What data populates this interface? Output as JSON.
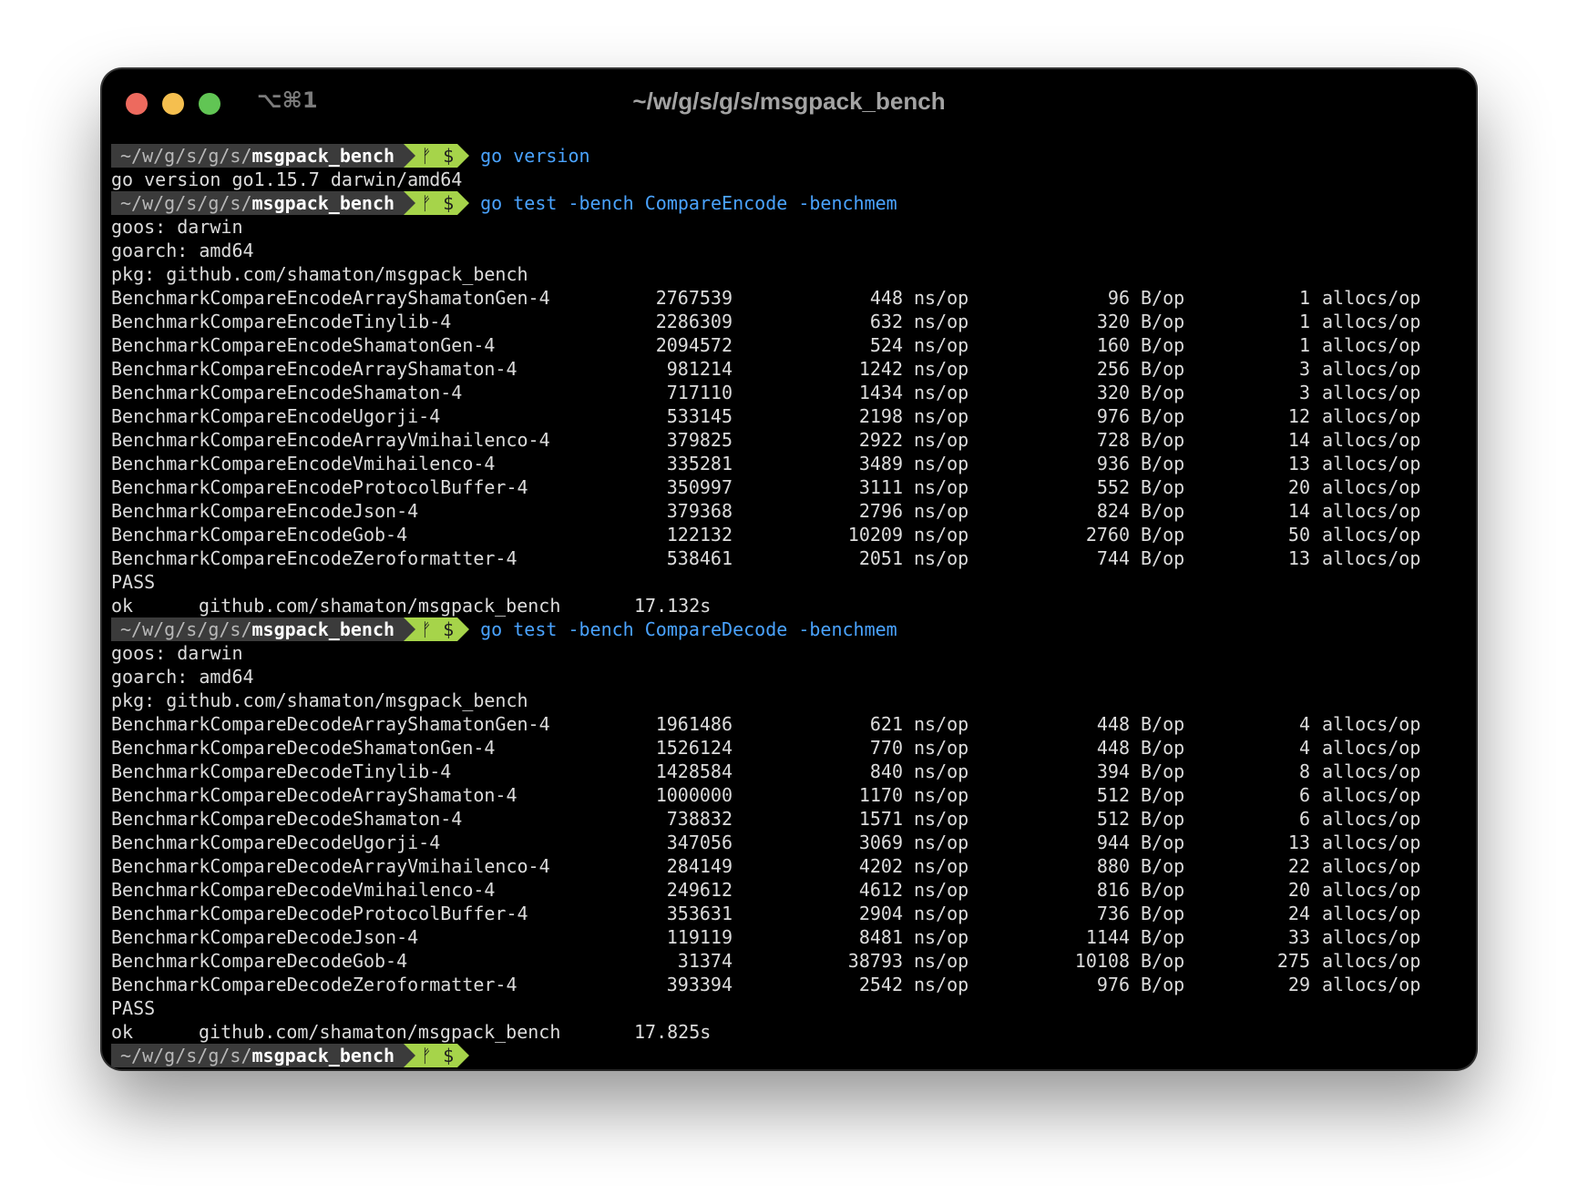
{
  "window": {
    "shortcut": "⌥⌘1",
    "title": "~/w/g/s/g/s/msgpack_bench"
  },
  "prompt": {
    "path_prefix": "~/w/g/s/g/s/",
    "dir": "msgpack_bench",
    "git_symbol": "ᚠ",
    "dollar": "$"
  },
  "cmd1": "go version",
  "version_output": "go version go1.15.7 darwin/amd64",
  "encode": {
    "cmd": "go test -bench CompareEncode -benchmem",
    "goos": "goos: darwin",
    "goarch": "goarch: amd64",
    "pkg": "pkg: github.com/shamaton/msgpack_bench",
    "ns_unit": "ns/op",
    "b_unit": "B/op",
    "a_unit": "allocs/op",
    "rows": [
      {
        "name": "BenchmarkCompareEncodeArrayShamatonGen-4",
        "n": "2767539",
        "ns": "448",
        "b": "96",
        "a": "1"
      },
      {
        "name": "BenchmarkCompareEncodeTinylib-4",
        "n": "2286309",
        "ns": "632",
        "b": "320",
        "a": "1"
      },
      {
        "name": "BenchmarkCompareEncodeShamatonGen-4",
        "n": "2094572",
        "ns": "524",
        "b": "160",
        "a": "1"
      },
      {
        "name": "BenchmarkCompareEncodeArrayShamaton-4",
        "n": "981214",
        "ns": "1242",
        "b": "256",
        "a": "3"
      },
      {
        "name": "BenchmarkCompareEncodeShamaton-4",
        "n": "717110",
        "ns": "1434",
        "b": "320",
        "a": "3"
      },
      {
        "name": "BenchmarkCompareEncodeUgorji-4",
        "n": "533145",
        "ns": "2198",
        "b": "976",
        "a": "12"
      },
      {
        "name": "BenchmarkCompareEncodeArrayVmihailenco-4",
        "n": "379825",
        "ns": "2922",
        "b": "728",
        "a": "14"
      },
      {
        "name": "BenchmarkCompareEncodeVmihailenco-4",
        "n": "335281",
        "ns": "3489",
        "b": "936",
        "a": "13"
      },
      {
        "name": "BenchmarkCompareEncodeProtocolBuffer-4",
        "n": "350997",
        "ns": "3111",
        "b": "552",
        "a": "20"
      },
      {
        "name": "BenchmarkCompareEncodeJson-4",
        "n": "379368",
        "ns": "2796",
        "b": "824",
        "a": "14"
      },
      {
        "name": "BenchmarkCompareEncodeGob-4",
        "n": "122132",
        "ns": "10209",
        "b": "2760",
        "a": "50"
      },
      {
        "name": "BenchmarkCompareEncodeZeroformatter-4",
        "n": "538461",
        "ns": "2051",
        "b": "744",
        "a": "13"
      }
    ],
    "pass": "PASS",
    "ok": "ok",
    "ok_pkg": "github.com/shamaton/msgpack_bench",
    "ok_time": "17.132s"
  },
  "decode": {
    "cmd": "go test -bench CompareDecode -benchmem",
    "goos": "goos: darwin",
    "goarch": "goarch: amd64",
    "pkg": "pkg: github.com/shamaton/msgpack_bench",
    "ns_unit": "ns/op",
    "b_unit": "B/op",
    "a_unit": "allocs/op",
    "rows": [
      {
        "name": "BenchmarkCompareDecodeArrayShamatonGen-4",
        "n": "1961486",
        "ns": "621",
        "b": "448",
        "a": "4"
      },
      {
        "name": "BenchmarkCompareDecodeShamatonGen-4",
        "n": "1526124",
        "ns": "770",
        "b": "448",
        "a": "4"
      },
      {
        "name": "BenchmarkCompareDecodeTinylib-4",
        "n": "1428584",
        "ns": "840",
        "b": "394",
        "a": "8"
      },
      {
        "name": "BenchmarkCompareDecodeArrayShamaton-4",
        "n": "1000000",
        "ns": "1170",
        "b": "512",
        "a": "6"
      },
      {
        "name": "BenchmarkCompareDecodeShamaton-4",
        "n": "738832",
        "ns": "1571",
        "b": "512",
        "a": "6"
      },
      {
        "name": "BenchmarkCompareDecodeUgorji-4",
        "n": "347056",
        "ns": "3069",
        "b": "944",
        "a": "13"
      },
      {
        "name": "BenchmarkCompareDecodeArrayVmihailenco-4",
        "n": "284149",
        "ns": "4202",
        "b": "880",
        "a": "22"
      },
      {
        "name": "BenchmarkCompareDecodeVmihailenco-4",
        "n": "249612",
        "ns": "4612",
        "b": "816",
        "a": "20"
      },
      {
        "name": "BenchmarkCompareDecodeProtocolBuffer-4",
        "n": "353631",
        "ns": "2904",
        "b": "736",
        "a": "24"
      },
      {
        "name": "BenchmarkCompareDecodeJson-4",
        "n": "119119",
        "ns": "8481",
        "b": "1144",
        "a": "33"
      },
      {
        "name": "BenchmarkCompareDecodeGob-4",
        "n": "31374",
        "ns": "38793",
        "b": "10108",
        "a": "275"
      },
      {
        "name": "BenchmarkCompareDecodeZeroformatter-4",
        "n": "393394",
        "ns": "2542",
        "b": "976",
        "a": "29"
      }
    ],
    "pass": "PASS",
    "ok": "ok",
    "ok_pkg": "github.com/shamaton/msgpack_bench",
    "ok_time": "17.825s"
  }
}
